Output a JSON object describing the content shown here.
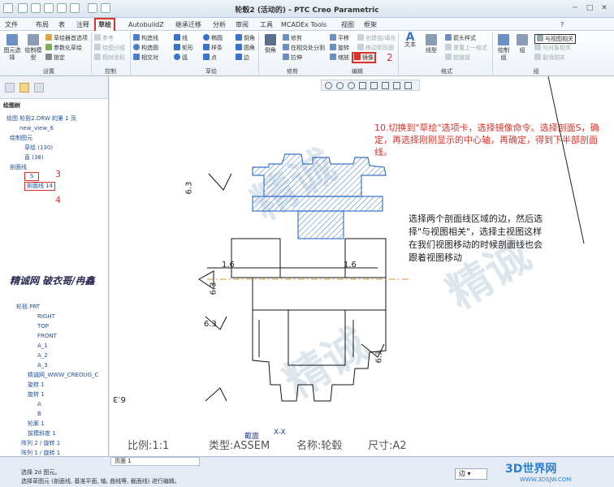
{
  "window": {
    "title": "轮毂2 (活动的) - PTC Creo Parametric"
  },
  "menu_tabs": [
    "文件",
    "布局",
    "表",
    "注释",
    "草绘",
    "AutobuildZ",
    "继承迁移",
    "分析",
    "审阅",
    "工具",
    "MCADEx Tools",
    "视图",
    "框架"
  ],
  "ribbon": {
    "settings": {
      "select_label": "图元选择",
      "drawing_model_label": "绘制模型",
      "items": [
        "草绘器首选项",
        "参数化草绘",
        "锁定"
      ],
      "group": "设置"
    },
    "control": {
      "items": [
        "参考",
        "绘图分组",
        "相对坐标"
      ],
      "group": "控制"
    },
    "sketch": {
      "items": [
        "构造线",
        "构造圆",
        "相交对",
        "线",
        "矩形",
        "弧",
        "椭圆",
        "样条",
        "点",
        "倒角",
        "圆角",
        "边"
      ],
      "group": "草绘"
    },
    "modify": {
      "items": [
        "修剪",
        "在相交处分割",
        "拉伸",
        "边界",
        "旋转",
        "缩放",
        "镜像",
        "平移",
        "创建组/填充",
        "移动到页面"
      ],
      "big": [
        "倒角"
      ],
      "group": "修剪",
      "mirror_label": "镜像"
    },
    "edit": {
      "group": "编辑"
    },
    "format": {
      "items": [
        "文本样式",
        "线型",
        "箭头样式",
        "重置上一格式",
        "超链接"
      ],
      "big": [
        "文本",
        "线型"
      ],
      "group": "格式"
    },
    "group2": {
      "items": [
        "绘制组",
        "组",
        "与视图相关",
        "与对象相关",
        "取消相关"
      ],
      "highlight": "与视图相关",
      "group": "组"
    }
  },
  "left_panel": {
    "title": "绘图树",
    "tree": [
      "绘图 轮毂2.DRW 的第 1 页",
      "new_view_6",
      "绘制图元",
      "草绘 (130)",
      "直 (38)",
      "剖面线",
      "S",
      "剖面线 14"
    ],
    "model_tree": [
      "轮毂.PRT",
      "RIGHT",
      "TOP",
      "FRONT",
      "A_1",
      "A_2",
      "A_3",
      "精诚网_WWW_CREOUG_C",
      "旋转 1",
      "旋转 1",
      "A",
      "B",
      "轮廓 1",
      "拔模斜度 1",
      "阵列 2 / 旋转 1",
      "阵列 1 / 旋转 1"
    ],
    "marker_3": "3",
    "marker_4": "4",
    "caption": "精诚网 破衣哥/冉鑫"
  },
  "canvas": {
    "instruction_red": "10.切换到\"草绘\"选项卡，选择镜像命令。选择剖面S，确定，再选择刚刚显示的中心轴，再确定，得到下半部剖面线。",
    "instruction_black": "选择两个剖面线区域的边，然后选择\"与视图相关\"，选择主视图这样在我们视图移动的时候剖面线也会跟着视图移动",
    "marker_2": "2",
    "dims": [
      "6.3",
      "1.6",
      "1.6",
      "6.3",
      "6.3",
      "6.3",
      "6.3"
    ],
    "section_label": "截面",
    "section_name": "X-X",
    "scale": "比例:1:1",
    "type": "类型:ASSEM",
    "name": "名称:轮毂",
    "size": "尺寸:A2",
    "page_tab": "页面 1"
  },
  "status": {
    "line1": "选择 2d 图元。",
    "line2": "选择草图元 (剖面线, 基准平面, 轴, 曲线等, 截面线) 进行编辑。",
    "filter": "边",
    "logo": "3D世界网",
    "url": "WWW.3DSJW.COM"
  },
  "colors": {
    "accent": "#d9342b",
    "model_blue": "#3a74c9",
    "ribbon_bg": "#edf2f8"
  }
}
